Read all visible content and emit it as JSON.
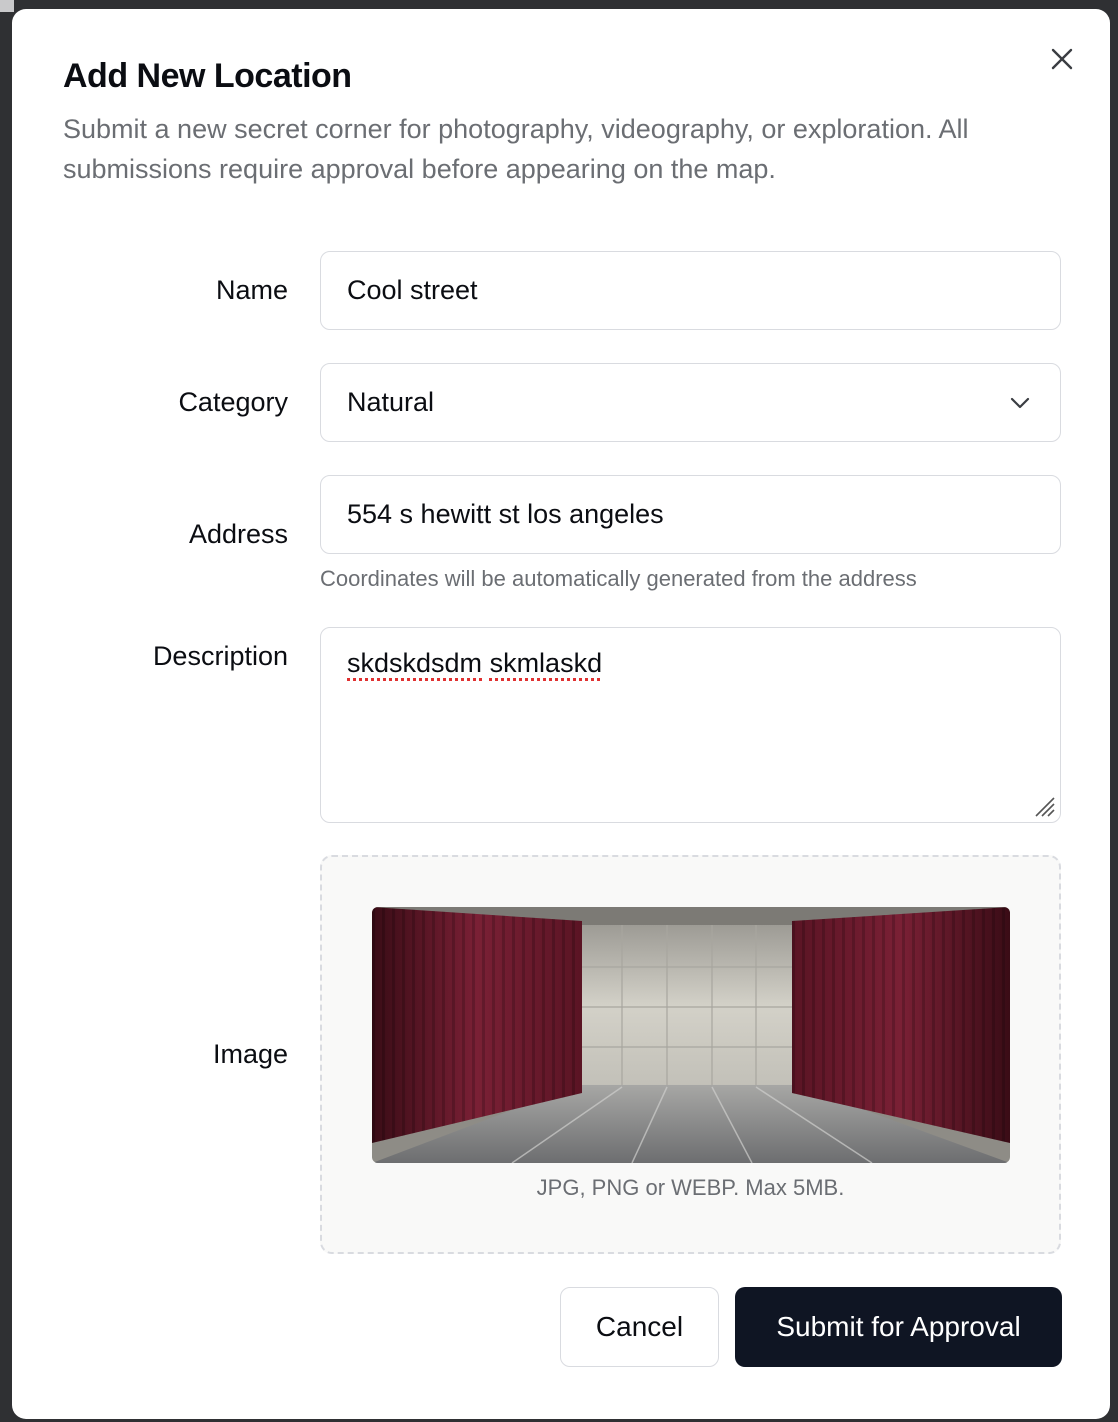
{
  "dialog": {
    "title": "Add New Location",
    "subtitle": "Submit a new secret corner for photography, videography, or exploration. All submissions require approval before appearing on the map.",
    "close_icon": "close-icon"
  },
  "form": {
    "name": {
      "label": "Name",
      "value": "Cool street"
    },
    "category": {
      "label": "Category",
      "value": "Natural",
      "icon": "chevron-down-icon"
    },
    "address": {
      "label": "Address",
      "value": "554 s hewitt st los angeles",
      "helper": "Coordinates will be automatically generated from the address"
    },
    "description": {
      "label": "Description",
      "word1": "skdskdsdm",
      "word2": "skmlaskd"
    },
    "image": {
      "label": "Image",
      "hint": "JPG, PNG or WEBP. Max 5MB."
    }
  },
  "actions": {
    "cancel_label": "Cancel",
    "submit_label": "Submit for Approval"
  },
  "colors": {
    "primary_button": "#0f1523",
    "border": "#d9dbe0",
    "muted_text": "#6b6e73",
    "curtain": "#6e1a2c"
  }
}
